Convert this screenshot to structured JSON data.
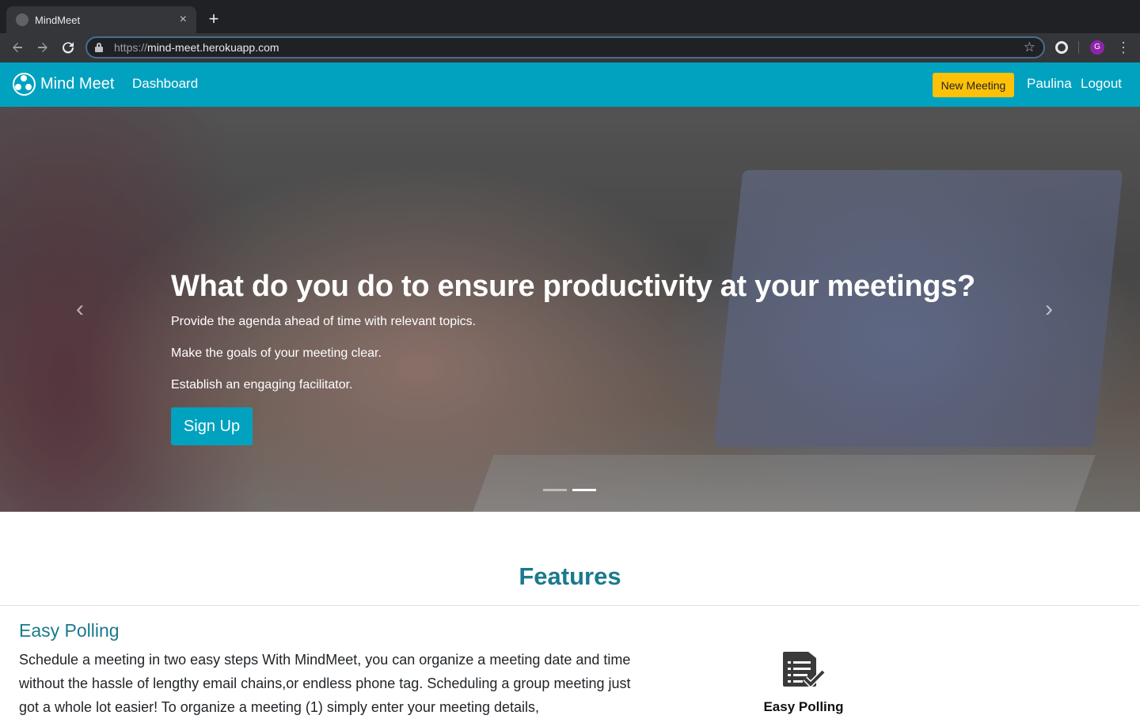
{
  "browser": {
    "tab_title": "MindMeet",
    "url_scheme": "https://",
    "url_host": "mind-meet.herokuapp.com",
    "profile_initial": "G",
    "tab_close": "×",
    "new_tab": "+"
  },
  "navbar": {
    "brand": "Mind Meet",
    "dashboard": "Dashboard",
    "new_meeting": "New Meeting",
    "user": "Paulina",
    "logout": "Logout",
    "accent_color": "#00a2c0",
    "button_color": "#ffc107"
  },
  "hero": {
    "title": "What do you do to ensure productivity at your meetings?",
    "lines": [
      "Provide the agenda ahead of time with relevant topics.",
      "Make the goals of your meeting clear.",
      "Establish an engaging facilitator."
    ],
    "cta": "Sign Up",
    "prev_glyph": "‹",
    "next_glyph": "›"
  },
  "features": {
    "title": "Features",
    "item_heading": "Easy Polling",
    "item_text": "Schedule a meeting in two easy steps With MindMeet, you can organize a meeting date and time without the hassle of lengthy email chains,or endless phone tag. Scheduling a group meeting just got a whole lot easier! To organize a meeting (1) simply enter your meeting details,",
    "icon": "checklist-icon",
    "icon_label": "Easy Polling",
    "heading_color": "#1a7a8c"
  }
}
